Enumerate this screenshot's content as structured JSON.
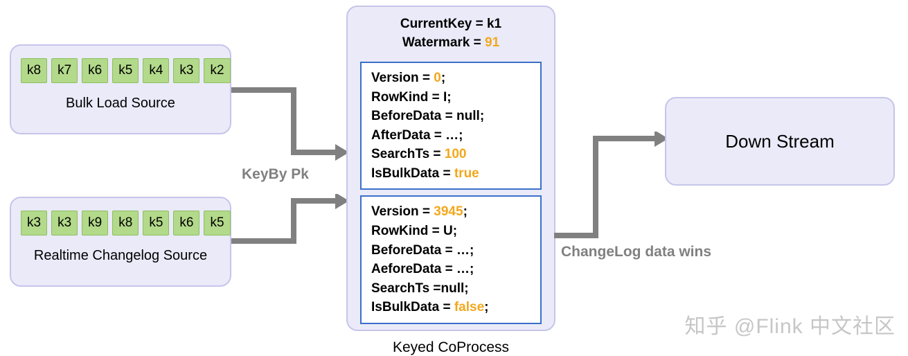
{
  "sources": {
    "bulk": {
      "label": "Bulk Load Source",
      "keys": [
        "k8",
        "k7",
        "k6",
        "k5",
        "k4",
        "k3",
        "k2"
      ]
    },
    "realtime": {
      "label": "Realtime Changelog Source",
      "keys": [
        "k3",
        "k3",
        "k9",
        "k8",
        "k5",
        "k6",
        "k5"
      ]
    }
  },
  "edges": {
    "keyby": "KeyBy Pk",
    "wins": "ChangeLog data wins"
  },
  "coprocess": {
    "title": "Keyed CoProcess",
    "header": {
      "currentKeyLabel": "CurrentKey = ",
      "currentKey": "k1",
      "watermarkLabel": "Watermark =  ",
      "watermark": "91"
    },
    "panel1": {
      "versionLabel": "Version = ",
      "version": "0",
      "versionSuffix": ";",
      "rowKindLabel": "RowKind = ",
      "rowKind": "I",
      "rowKindSuffix": ";",
      "beforeLabel": "BeforeData = ",
      "before": "null",
      "beforeSuffix": ";",
      "afterLabel": "AfterData = ",
      "after": "…",
      "afterSuffix": ";",
      "searchTsLabel": "SearchTs = ",
      "searchTs": "100",
      "isBulkLabel": "IsBulkData = ",
      "isBulk": "true"
    },
    "panel2": {
      "versionLabel": "Version = ",
      "version": "3945",
      "versionSuffix": ";",
      "rowKindLabel": "RowKind = ",
      "rowKind": "U",
      "rowKindSuffix": ";",
      "beforeLabel": "BeforeData = ",
      "before": "…",
      "beforeSuffix": ";",
      "afterLabel": "AeforeData = ",
      "after": "…",
      "afterSuffix": ";",
      "searchTsLabel": "SearchTs =",
      "searchTs": "null",
      "searchTsSuffix": ";",
      "isBulkLabel": "IsBulkData = ",
      "isBulk": "false",
      "isBulkSuffix": ";"
    }
  },
  "downstream": {
    "label": "Down Stream"
  },
  "watermarkText": "知乎 @Flink 中文社区"
}
